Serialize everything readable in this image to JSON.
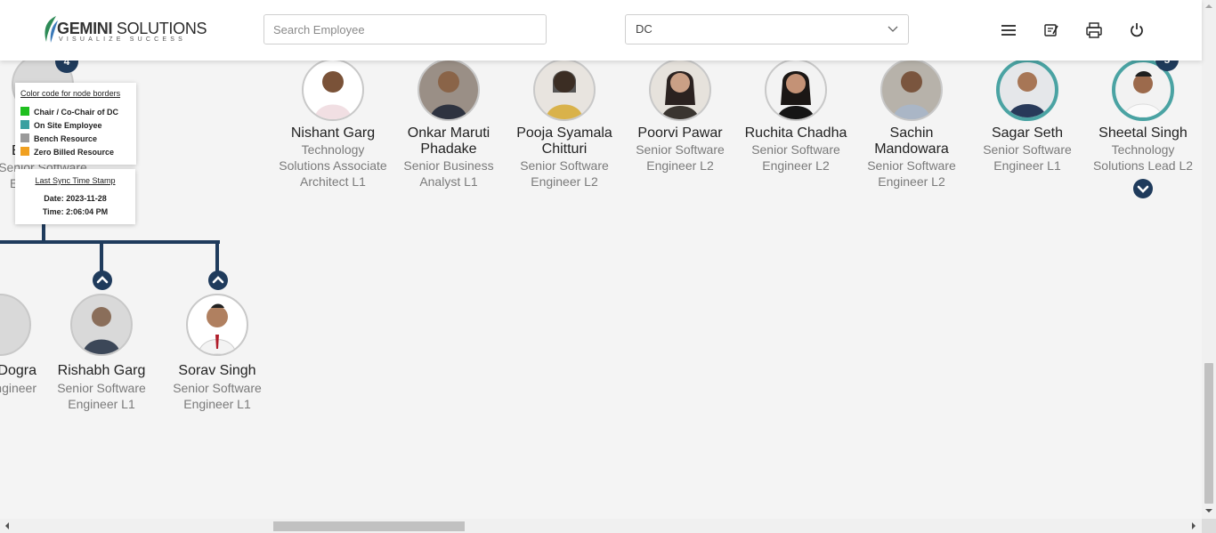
{
  "header": {
    "logo_text_bold": "GEMINI",
    "logo_text": " SOLUTIONS",
    "logo_tagline": "VISUALIZE SUCCESS",
    "search": {
      "placeholder": "Search Employee",
      "value": ""
    },
    "dc_select": {
      "value": "DC"
    },
    "icons": [
      "menu-icon",
      "edit-note-icon",
      "print-icon",
      "power-icon"
    ]
  },
  "left_partial": {
    "top_badge": "4",
    "top_name_fragment": "E",
    "top_title_line1": "Senior Software",
    "top_title_line2": "E",
    "bottom_name": "Dogra",
    "bottom_title": "ngineer"
  },
  "legend": {
    "title": "Color code for node borders",
    "items": [
      {
        "label": "Chair / Co-Chair of DC",
        "color": "#1fbf1f"
      },
      {
        "label": "On Site Employee",
        "color": "#3aa0a0"
      },
      {
        "label": "Bench Resource",
        "color": "#9a9a9a"
      },
      {
        "label": "Zero Billed Resource",
        "color": "#f0a020"
      }
    ]
  },
  "sync": {
    "title": "Last Sync Time Stamp",
    "date": "Date: 2023-11-28",
    "time": "Time: 2:06:04 PM"
  },
  "top_nodes": [
    {
      "name": "Nishant Garg",
      "title": "Technology Solutions Associate Architect L1",
      "border": "bench"
    },
    {
      "name": "Onkar Maruti Phadake",
      "title": "Senior Business Analyst L1",
      "border": "bench"
    },
    {
      "name": "Pooja Syamala Chitturi",
      "title": "Senior Software Engineer L2",
      "border": "bench"
    },
    {
      "name": "Poorvi Pawar",
      "title": "Senior Software Engineer L2",
      "border": "bench"
    },
    {
      "name": "Ruchita Chadha",
      "title": "Senior Software Engineer L2",
      "border": "bench"
    },
    {
      "name": "Sachin Mandowara",
      "title": "Senior Software Engineer L2",
      "border": "bench"
    },
    {
      "name": "Sagar Seth",
      "title": "Senior Software Engineer L1",
      "border": "onsite"
    },
    {
      "name": "Sheetal Singh",
      "title": "Technology Solutions Lead L2",
      "border": "onsite",
      "badge": "5"
    }
  ],
  "bottom_nodes": [
    {
      "name": "Rishabh Garg",
      "title": "Senior Software Engineer L1"
    },
    {
      "name": "Sorav Singh",
      "title": "Senior Software Engineer L1"
    }
  ],
  "colors": {
    "accent": "#1f3b5c",
    "onsite": "#4aa3a3"
  }
}
